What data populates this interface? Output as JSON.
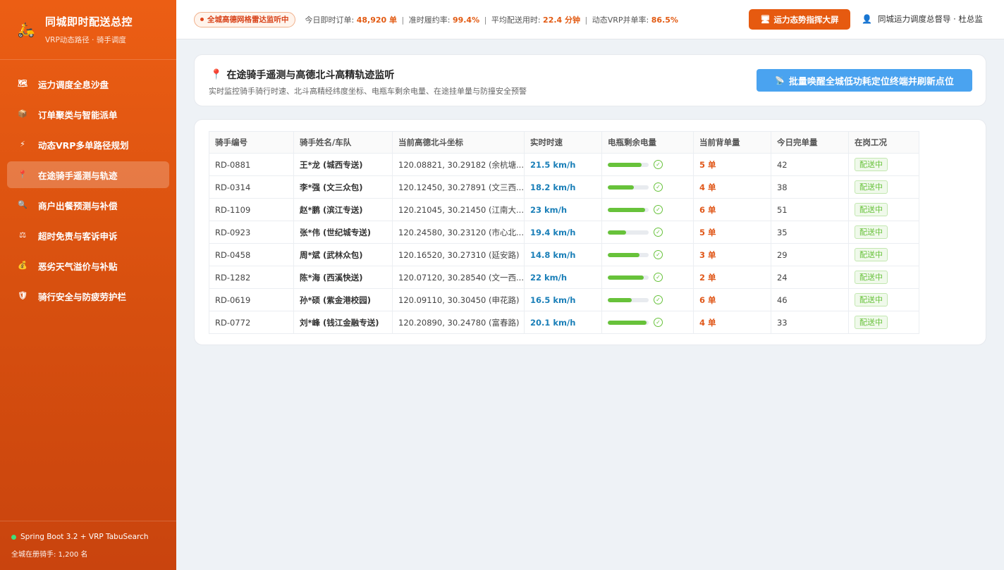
{
  "sidebar": {
    "brand_title": "同城即时配送总控",
    "brand_subtitle": "VRP动态路径 · 骑手调度",
    "items": [
      {
        "label": "运力调度全息沙盘",
        "icon": "map-icon"
      },
      {
        "label": "订单聚类与智能派单",
        "icon": "package-icon"
      },
      {
        "label": "动态VRP多单路径规划",
        "icon": "lightning-icon"
      },
      {
        "label": "在途骑手遥测与轨迹",
        "icon": "pin-icon"
      },
      {
        "label": "商户出餐预测与补偿",
        "icon": "magnifier-icon"
      },
      {
        "label": "超时免责与客诉申诉",
        "icon": "scales-icon"
      },
      {
        "label": "恶劣天气溢价与补贴",
        "icon": "moneybag-icon"
      },
      {
        "label": "骑行安全与防疲劳护栏",
        "icon": "shield-icon"
      }
    ],
    "active_index": 3,
    "footer_tech": "Spring Boot 3.2 + VRP TabuSearch",
    "footer_riders": "全城在册骑手: 1,200 名"
  },
  "topbar": {
    "live_label": "全城高德网格雷达监听中",
    "stats": {
      "orders_label": "今日即时订单:",
      "orders_value": "48,920 单",
      "ontime_label": "准时履约率:",
      "ontime_value": "99.4%",
      "avg_label": "平均配送用时:",
      "avg_value": "22.4 分钟",
      "vrp_label": "动态VRP并单率:",
      "vrp_value": "86.5%"
    },
    "screen_button": "运力态势指挥大屏",
    "user": "同城运力调度总督导 · 杜总监"
  },
  "header": {
    "title": "在途骑手遥测与高德北斗高精轨迹监听",
    "description": "实时监控骑手骑行时速、北斗高精经纬度坐标、电瓶车剩余电量、在途挂单量与防撞安全预警",
    "wake_button": "批量唤醒全城低功耗定位终端并刷新点位"
  },
  "table": {
    "columns": [
      "骑手编号",
      "骑手姓名/车队",
      "当前高德北斗坐标",
      "实时时速",
      "电瓶剩余电量",
      "当前背单量",
      "今日完单量",
      "在岗工况"
    ],
    "rows": [
      {
        "id": "RD-0881",
        "name": "王*龙 (城西专送)",
        "coord": "120.08821, 30.29182 (余杭塘...",
        "speed": "21.5 km/h",
        "battery": 0.82,
        "orders": "5 单",
        "done": "42",
        "status": "配送中"
      },
      {
        "id": "RD-0314",
        "name": "李*强 (文三众包)",
        "coord": "120.12450, 30.27891 (文三西...",
        "speed": "18.2 km/h",
        "battery": 0.64,
        "orders": "4 单",
        "done": "38",
        "status": "配送中"
      },
      {
        "id": "RD-1109",
        "name": "赵*鹏 (滨江专送)",
        "coord": "120.21045, 30.21450 (江南大...",
        "speed": "23 km/h",
        "battery": 0.91,
        "orders": "6 单",
        "done": "51",
        "status": "配送中"
      },
      {
        "id": "RD-0923",
        "name": "张*伟 (世纪城专送)",
        "coord": "120.24580, 30.23120 (市心北...",
        "speed": "19.4 km/h",
        "battery": 0.45,
        "orders": "5 单",
        "done": "35",
        "status": "配送中"
      },
      {
        "id": "RD-0458",
        "name": "周*斌 (武林众包)",
        "coord": "120.16520, 30.27310 (延安路)",
        "speed": "14.8 km/h",
        "battery": 0.78,
        "orders": "3 单",
        "done": "29",
        "status": "配送中"
      },
      {
        "id": "RD-1282",
        "name": "陈*海 (西溪快送)",
        "coord": "120.07120, 30.28540 (文一西...",
        "speed": "22 km/h",
        "battery": 0.88,
        "orders": "2 单",
        "done": "24",
        "status": "配送中"
      },
      {
        "id": "RD-0619",
        "name": "孙*硕 (紫金港校园)",
        "coord": "120.09110, 30.30450 (申花路)",
        "speed": "16.5 km/h",
        "battery": 0.58,
        "orders": "6 单",
        "done": "46",
        "status": "配送中"
      },
      {
        "id": "RD-0772",
        "name": "刘*峰 (钱江金融专送)",
        "coord": "120.20890, 30.24780 (富春路)",
        "speed": "20.1 km/h",
        "battery": 0.95,
        "orders": "4 单",
        "done": "33",
        "status": "配送中"
      }
    ]
  }
}
